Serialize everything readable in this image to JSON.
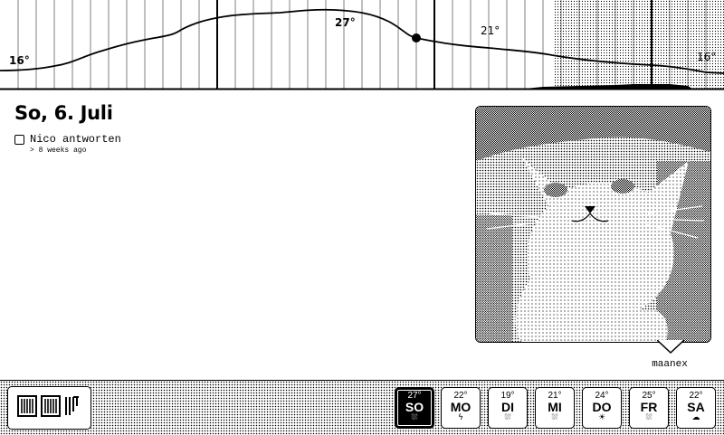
{
  "forecast": {
    "labels": [
      "16°",
      "27°",
      "21°",
      "16°"
    ]
  },
  "day": {
    "title": "So, 6. Juli"
  },
  "todos": [
    {
      "text": "Nico antworten",
      "meta": "> 8 weeks ago"
    }
  ],
  "photo": {
    "caption": "maanex",
    "subject_icon": "cat-photo"
  },
  "view_switcher": {
    "icons": [
      "calendar-view-icon",
      "grid-view-icon",
      "columns-view-icon"
    ]
  },
  "week": [
    {
      "temp": "27°",
      "name": "SO",
      "icon": "rain-icon",
      "glyph": "⛆",
      "active": true
    },
    {
      "temp": "22°",
      "name": "MO",
      "icon": "thunder-icon",
      "glyph": "ϟ",
      "active": false
    },
    {
      "temp": "19°",
      "name": "DI",
      "icon": "rain-icon",
      "glyph": "⛆",
      "active": false
    },
    {
      "temp": "21°",
      "name": "MI",
      "icon": "rain-icon",
      "glyph": "⛆",
      "active": false
    },
    {
      "temp": "24°",
      "name": "DO",
      "icon": "sun-icon",
      "glyph": "☀",
      "active": false
    },
    {
      "temp": "25°",
      "name": "FR",
      "icon": "rain-icon",
      "glyph": "⛆",
      "active": false
    },
    {
      "temp": "22°",
      "name": "SA",
      "icon": "cloud-rain-icon",
      "glyph": "☁",
      "active": false
    }
  ]
}
